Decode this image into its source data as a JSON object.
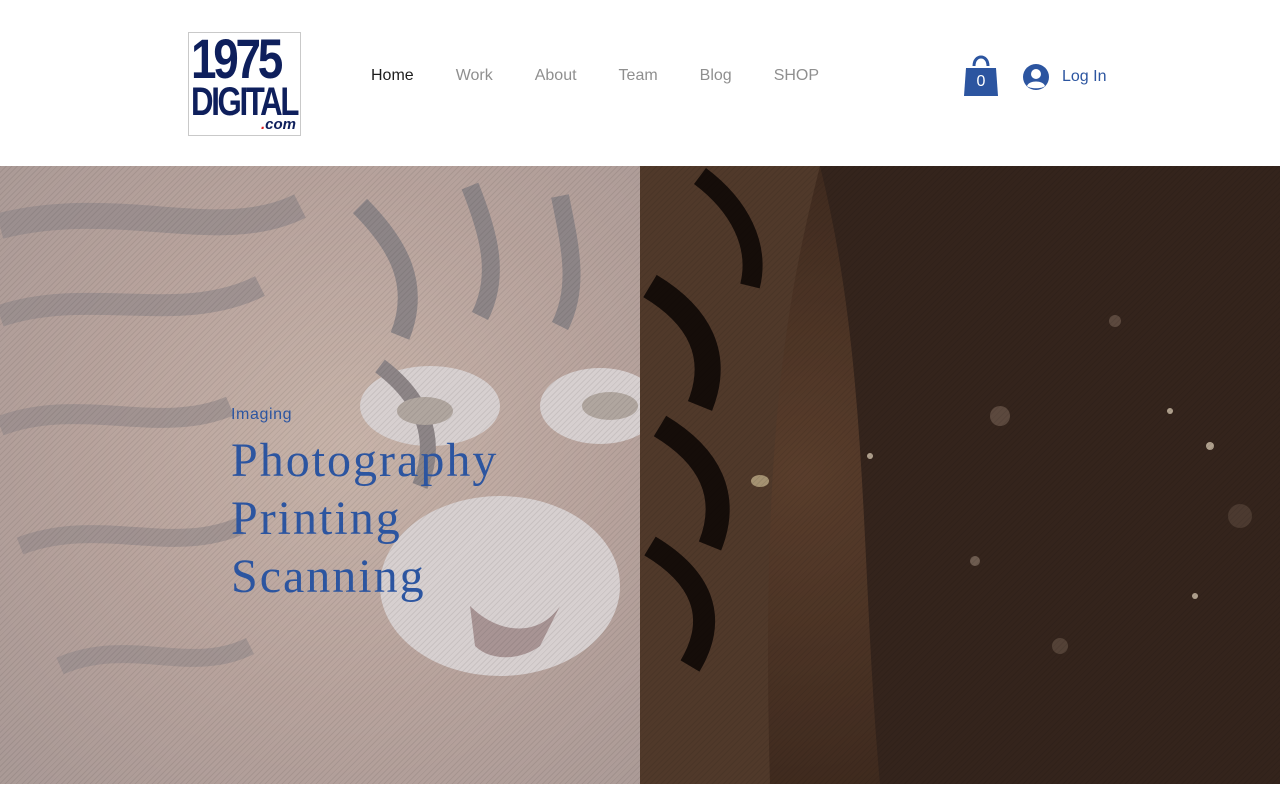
{
  "logo": {
    "line1": "1975",
    "line2": "DIGITAL",
    "line3_dot": ".",
    "line3": "com"
  },
  "nav": {
    "items": [
      {
        "label": "Home",
        "active": true
      },
      {
        "label": "Work",
        "active": false
      },
      {
        "label": "About",
        "active": false
      },
      {
        "label": "Team",
        "active": false
      },
      {
        "label": "Blog",
        "active": false
      },
      {
        "label": "SHOP",
        "active": false
      }
    ]
  },
  "cart": {
    "icon": "shopping-bag-icon",
    "count": "0"
  },
  "login": {
    "icon": "user-avatar-icon",
    "label": "Log In"
  },
  "hero": {
    "image": "tiger-icon",
    "kicker": "Imaging",
    "headline": [
      "Photography",
      "Printing",
      "Scanning"
    ]
  },
  "colors": {
    "brand_navy": "#0e1f5c",
    "accent_blue": "#2c55a0",
    "nav_inactive": "#8f8f8f",
    "nav_active": "#1d1d1d"
  }
}
